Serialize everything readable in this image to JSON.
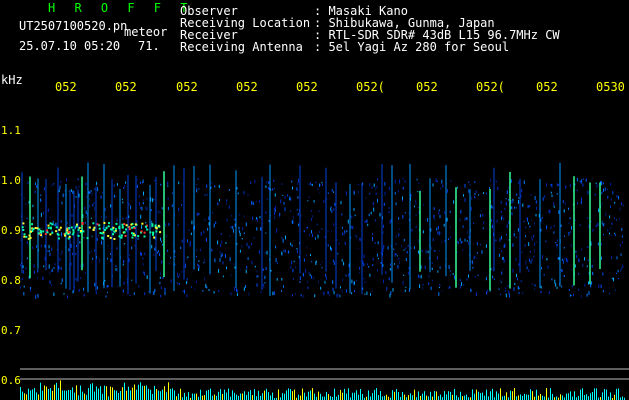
{
  "header": {
    "brand": "H R O F F T",
    "filename": "UT2507100520.pn",
    "event_type": "meteor",
    "timestamp": "25.07.10 05:20",
    "count": "71."
  },
  "station_info": [
    {
      "key": "Observer",
      "value": ": Masaki Kano"
    },
    {
      "key": "Receiving Location",
      "value": ": Shibukawa, Gunma, Japan"
    },
    {
      "key": "Receiver",
      "value": ": RTL-SDR SDR# 43dB L15 96.7MHz CW"
    },
    {
      "key": "Receiving Antenna",
      "value": ": 5el Yagi Az 280 for Seoul"
    }
  ],
  "axes": {
    "y_unit": "kHz",
    "x_ticks": [
      "052",
      "052",
      "052",
      "052",
      "052",
      "052(",
      "052",
      "052(",
      "052",
      "0530"
    ],
    "y_ticks": [
      "1.1",
      "1.0",
      "0.9",
      "0.8",
      "0.7",
      "0.6"
    ]
  },
  "colors": {
    "background": "#000000",
    "brand": "#00ff00",
    "labels": "#ffffff",
    "ticks": "#ffff00",
    "histogram_main": "#00ffff",
    "histogram_peaks": "#ffff00"
  }
}
